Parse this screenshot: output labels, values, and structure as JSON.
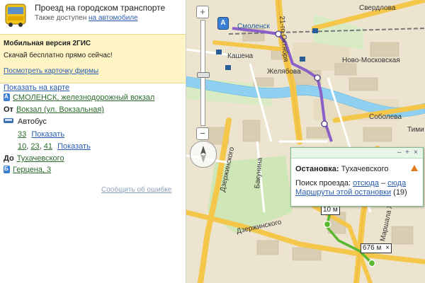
{
  "header": {
    "title": "Проезд на городском транспорте",
    "sub_prefix": "Также доступен ",
    "sub_link": "на автомобиле"
  },
  "promo": {
    "title": "Мобильная версия 2ГИС",
    "text": "Скачай бесплатно прямо сейчас!",
    "link": "Посмотреть карточку фирмы"
  },
  "route": {
    "show_on_map": "Показать на карте",
    "start_name": "СМОЛЕНСК, железнодорожный вокзал",
    "from_label": "От",
    "from_stop": "Вокзал (ул. Вокзальная)",
    "transport": "Автобус",
    "buses_row1": [
      "33"
    ],
    "buses_row2": [
      "10",
      "23",
      "41"
    ],
    "sep": ", ",
    "show_label": "Показать",
    "to_label": "До",
    "to_stop": "Тухачевского",
    "end_name": "Герцена, 3",
    "report_error": "Сообщить об ошибке"
  },
  "map": {
    "accent_route": "#8a5fc8",
    "walk_color": "#59b82e",
    "street_labels": {
      "sverdlova": "Свердлова",
      "oktyabrya": "21-го Октября",
      "smolensk": "Смоленск",
      "kashena": "Кашена",
      "zhelyabova": "Желябова",
      "novo_moskovskaya": "Ново-Московская",
      "soboleva": "Соболева",
      "dzerzhinskogo_v": "Дзержинского",
      "bakunina": "Бакунина",
      "dzerzhinskogo_h": "Дзержинского",
      "marshala": "Маршала Жу",
      "tim": "Тими"
    },
    "zoom_in": "+",
    "zoom_out": "−",
    "dist_badge_1": "10 м",
    "dist_badge_2": "676 м",
    "dist_close": "×",
    "marker_a": "A"
  },
  "popup": {
    "stop_label": "Остановка:",
    "stop_name": "Тухачевского",
    "search_prefix": "Поиск проезда:",
    "from_here": "отсюда",
    "dash": "–",
    "to_here": "сюда",
    "routes_link": "Маршруты этой остановки",
    "routes_count": "(19)",
    "ctl_min": "–",
    "ctl_pin": "+",
    "ctl_close": "×"
  }
}
